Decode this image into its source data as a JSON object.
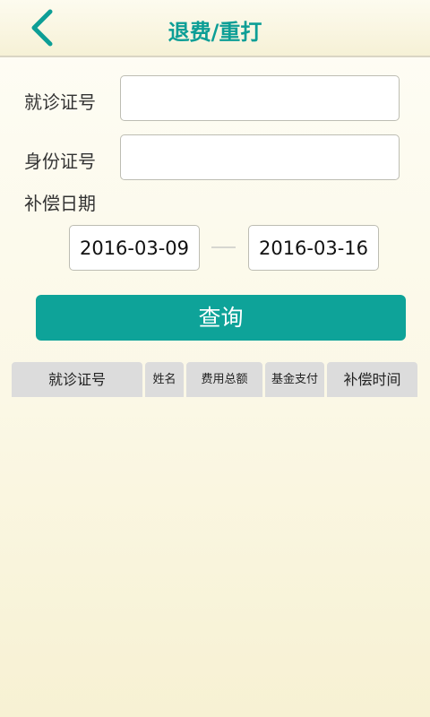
{
  "header": {
    "title": "退费/重打",
    "back_icon": "chevron-left-icon",
    "accent_color": "#0d9e96"
  },
  "form": {
    "visit_card_label": "就诊证号",
    "visit_card_value": "",
    "id_card_label": "身份证号",
    "id_card_value": "",
    "date_label": "补偿日期",
    "start_date": "2016-03-09",
    "end_date": "2016-03-16",
    "query_label": "查询"
  },
  "table": {
    "columns": [
      "就诊证号",
      "姓名",
      "费用总额",
      "基金支付",
      "补偿时间"
    ],
    "rows": []
  }
}
